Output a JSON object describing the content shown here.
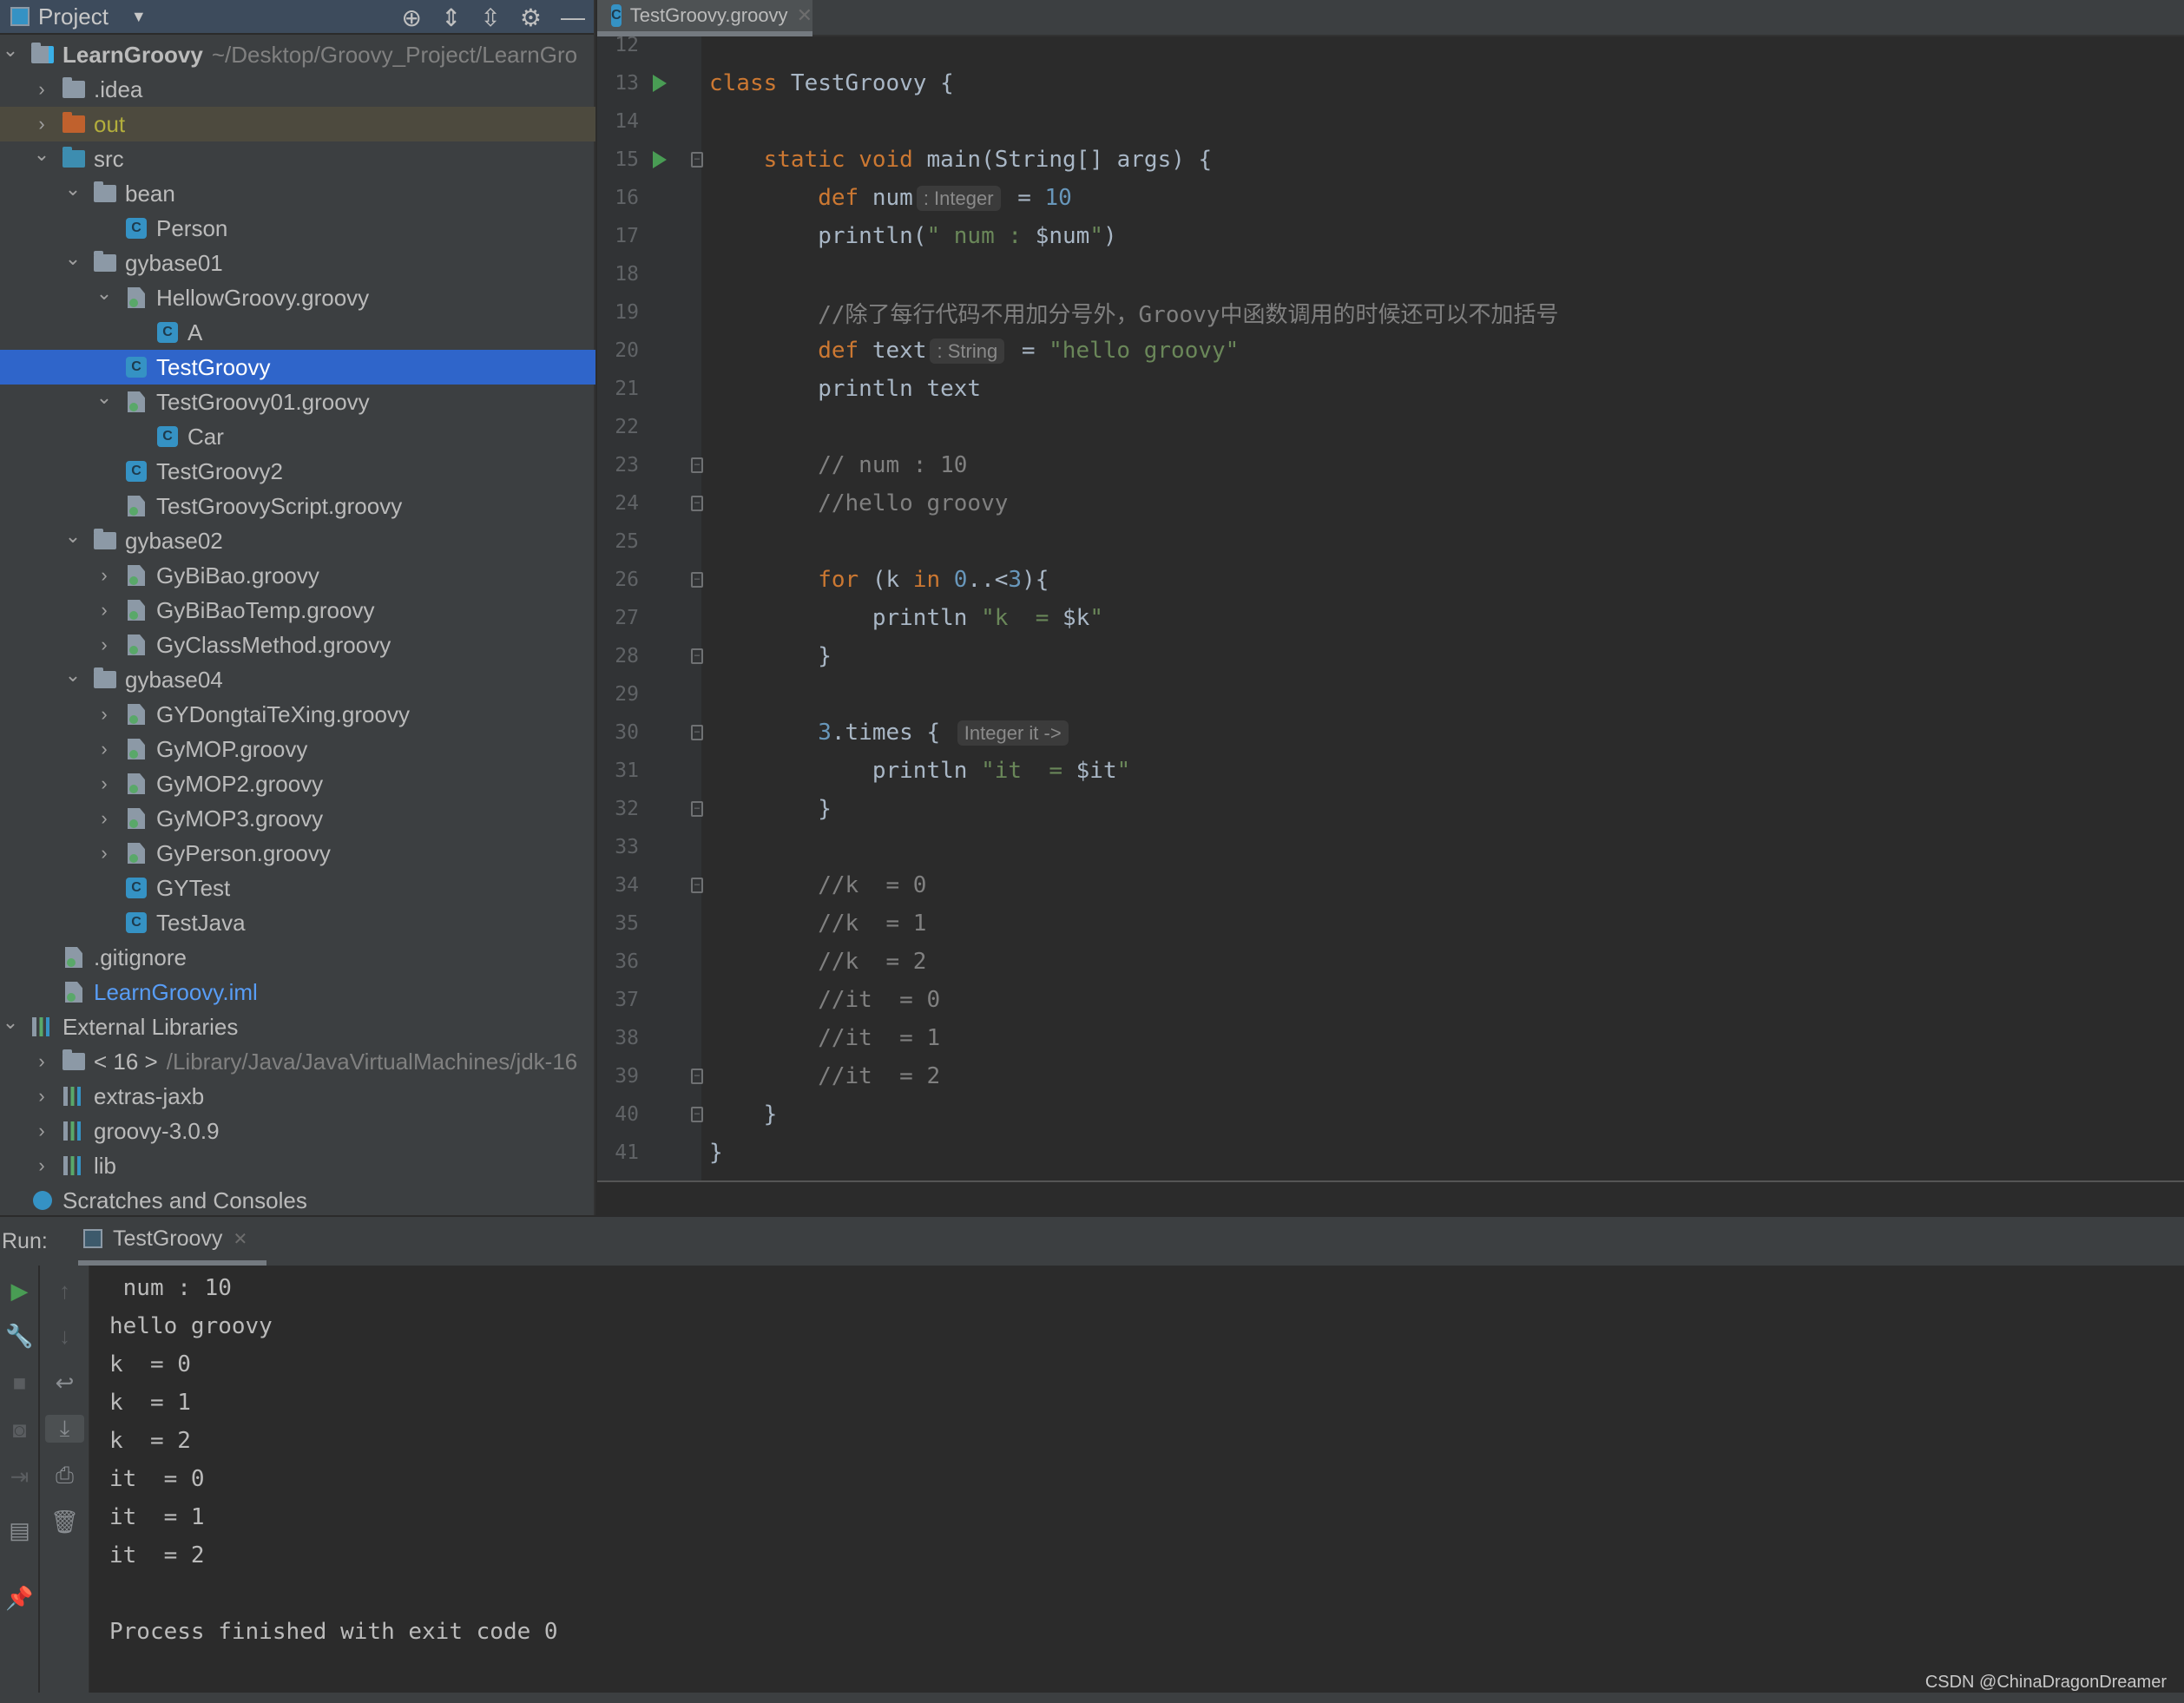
{
  "sidebar": {
    "title": "Project",
    "icons": [
      "target-icon",
      "expand-all-icon",
      "collapse-all-icon",
      "gear-icon",
      "minimize-icon"
    ],
    "items": [
      {
        "level": 0,
        "exp": "open",
        "icon": "module",
        "label": "LearnGroovy",
        "bold": true,
        "extra": "~/Desktop/Groovy_Project/LearnGro"
      },
      {
        "level": 1,
        "exp": "closed",
        "icon": "folder",
        "label": ".idea"
      },
      {
        "level": 1,
        "exp": "closed",
        "icon": "folder-out",
        "label": "out",
        "state": "excluded"
      },
      {
        "level": 1,
        "exp": "open",
        "icon": "folder-src",
        "label": "src"
      },
      {
        "level": 2,
        "exp": "open",
        "icon": "package",
        "label": "bean"
      },
      {
        "level": 3,
        "exp": "none",
        "icon": "class",
        "label": "Person"
      },
      {
        "level": 2,
        "exp": "open",
        "icon": "package",
        "label": "gybase01"
      },
      {
        "level": 3,
        "exp": "open",
        "icon": "groovy",
        "label": "HellowGroovy.groovy"
      },
      {
        "level": 4,
        "exp": "none",
        "icon": "class",
        "label": "A"
      },
      {
        "level": 3,
        "exp": "none",
        "icon": "class",
        "label": "TestGroovy",
        "selected": true
      },
      {
        "level": 3,
        "exp": "open",
        "icon": "groovy",
        "label": "TestGroovy01.groovy"
      },
      {
        "level": 4,
        "exp": "none",
        "icon": "class",
        "label": "Car"
      },
      {
        "level": 3,
        "exp": "none",
        "icon": "class",
        "label": "TestGroovy2"
      },
      {
        "level": 3,
        "exp": "none",
        "icon": "groovy",
        "label": "TestGroovyScript.groovy"
      },
      {
        "level": 2,
        "exp": "open",
        "icon": "package",
        "label": "gybase02"
      },
      {
        "level": 3,
        "exp": "closed",
        "icon": "groovy",
        "label": "GyBiBao.groovy"
      },
      {
        "level": 3,
        "exp": "closed",
        "icon": "groovy",
        "label": "GyBiBaoTemp.groovy"
      },
      {
        "level": 3,
        "exp": "closed",
        "icon": "groovy",
        "label": "GyClassMethod.groovy"
      },
      {
        "level": 2,
        "exp": "open",
        "icon": "package",
        "label": "gybase04"
      },
      {
        "level": 3,
        "exp": "closed",
        "icon": "groovy",
        "label": "GYDongtaiTeXing.groovy"
      },
      {
        "level": 3,
        "exp": "closed",
        "icon": "groovy",
        "label": "GyMOP.groovy"
      },
      {
        "level": 3,
        "exp": "closed",
        "icon": "groovy",
        "label": "GyMOP2.groovy"
      },
      {
        "level": 3,
        "exp": "closed",
        "icon": "groovy",
        "label": "GyMOP3.groovy"
      },
      {
        "level": 3,
        "exp": "closed",
        "icon": "groovy",
        "label": "GyPerson.groovy"
      },
      {
        "level": 3,
        "exp": "none",
        "icon": "class",
        "label": "GYTest"
      },
      {
        "level": 3,
        "exp": "none",
        "icon": "class",
        "label": "TestJava"
      },
      {
        "level": 1,
        "exp": "none",
        "icon": "file",
        "label": ".gitignore"
      },
      {
        "level": 1,
        "exp": "none",
        "icon": "file",
        "label": "LearnGroovy.iml",
        "link": true
      },
      {
        "level": 0,
        "exp": "open",
        "icon": "libraries",
        "label": "External Libraries"
      },
      {
        "level": 1,
        "exp": "closed",
        "icon": "jdk",
        "label": "< 16 >",
        "extra": "/Library/Java/JavaVirtualMachines/jdk-16"
      },
      {
        "level": 1,
        "exp": "closed",
        "icon": "library",
        "label": "extras-jaxb"
      },
      {
        "level": 1,
        "exp": "closed",
        "icon": "library",
        "label": "groovy-3.0.9"
      },
      {
        "level": 1,
        "exp": "closed",
        "icon": "library",
        "label": "lib"
      },
      {
        "level": 0,
        "exp": "none",
        "icon": "scratches",
        "label": "Scratches and Consoles"
      }
    ]
  },
  "editor": {
    "tab": "TestGroovy.groovy",
    "lines": [
      {
        "n": "12",
        "t": []
      },
      {
        "n": "13",
        "run": true,
        "t": [
          [
            "k",
            "class "
          ],
          [
            "d",
            "TestGroovy {"
          ]
        ]
      },
      {
        "n": "14",
        "t": []
      },
      {
        "n": "15",
        "run": true,
        "fold": true,
        "t": [
          [
            "d",
            "    "
          ],
          [
            "k",
            "static void "
          ],
          [
            "d",
            "main(String[] args) {"
          ]
        ]
      },
      {
        "n": "16",
        "t": [
          [
            "d",
            "        "
          ],
          [
            "k",
            "def "
          ],
          [
            "d",
            "num"
          ],
          [
            "h",
            ": Integer"
          ],
          [
            "d",
            " = "
          ],
          [
            "n",
            "10"
          ]
        ]
      },
      {
        "n": "17",
        "t": [
          [
            "d",
            "        println("
          ],
          [
            "s",
            "\" num : "
          ],
          [
            "d",
            "$num"
          ],
          [
            "s",
            "\""
          ],
          [
            "d",
            ")"
          ]
        ]
      },
      {
        "n": "18",
        "t": []
      },
      {
        "n": "19",
        "t": [
          [
            "c",
            "        //除了每行代码不用加分号外，Groovy中函数调用的时候还可以不加括号"
          ]
        ]
      },
      {
        "n": "20",
        "t": [
          [
            "d",
            "        "
          ],
          [
            "k",
            "def "
          ],
          [
            "d",
            "text"
          ],
          [
            "h",
            ": String"
          ],
          [
            "d",
            " = "
          ],
          [
            "s",
            "\"hello groovy\""
          ]
        ]
      },
      {
        "n": "21",
        "t": [
          [
            "d",
            "        println text"
          ]
        ]
      },
      {
        "n": "22",
        "t": []
      },
      {
        "n": "23",
        "fold": true,
        "t": [
          [
            "c",
            "        // num : 10"
          ]
        ]
      },
      {
        "n": "24",
        "fold": true,
        "t": [
          [
            "c",
            "        //hello groovy"
          ]
        ]
      },
      {
        "n": "25",
        "t": []
      },
      {
        "n": "26",
        "fold": true,
        "t": [
          [
            "d",
            "        "
          ],
          [
            "k",
            "for "
          ],
          [
            "d",
            "(k "
          ],
          [
            "k",
            "in "
          ],
          [
            "n",
            "0"
          ],
          [
            "d",
            "..<"
          ],
          [
            "n",
            "3"
          ],
          [
            "d",
            "){"
          ]
        ]
      },
      {
        "n": "27",
        "t": [
          [
            "d",
            "            println "
          ],
          [
            "s",
            "\"k  = "
          ],
          [
            "d",
            "$k"
          ],
          [
            "s",
            "\""
          ]
        ]
      },
      {
        "n": "28",
        "fold": true,
        "t": [
          [
            "d",
            "        }"
          ]
        ]
      },
      {
        "n": "29",
        "t": []
      },
      {
        "n": "30",
        "fold": true,
        "t": [
          [
            "d",
            "        "
          ],
          [
            "n",
            "3"
          ],
          [
            "d",
            ".times { "
          ],
          [
            "h",
            "Integer it ->"
          ]
        ]
      },
      {
        "n": "31",
        "t": [
          [
            "d",
            "            println "
          ],
          [
            "s",
            "\"it  = "
          ],
          [
            "d",
            "$it"
          ],
          [
            "s",
            "\""
          ]
        ]
      },
      {
        "n": "32",
        "fold": true,
        "t": [
          [
            "d",
            "        }"
          ]
        ]
      },
      {
        "n": "33",
        "t": []
      },
      {
        "n": "34",
        "fold": true,
        "t": [
          [
            "c",
            "        //k  = 0"
          ]
        ]
      },
      {
        "n": "35",
        "t": [
          [
            "c",
            "        //k  = 1"
          ]
        ]
      },
      {
        "n": "36",
        "t": [
          [
            "c",
            "        //k  = 2"
          ]
        ]
      },
      {
        "n": "37",
        "t": [
          [
            "c",
            "        //it  = 0"
          ]
        ]
      },
      {
        "n": "38",
        "t": [
          [
            "c",
            "        //it  = 1"
          ]
        ]
      },
      {
        "n": "39",
        "fold": true,
        "t": [
          [
            "c",
            "        //it  = 2"
          ]
        ]
      },
      {
        "n": "40",
        "fold": true,
        "t": [
          [
            "d",
            "    }"
          ]
        ]
      },
      {
        "n": "41",
        "t": [
          [
            "d",
            "}"
          ]
        ]
      }
    ]
  },
  "run": {
    "label": "Run:",
    "tab": "TestGroovy",
    "output": [
      " num : 10",
      "hello groovy",
      "k  = 0",
      "k  = 1",
      "k  = 2",
      "it  = 0",
      "it  = 1",
      "it  = 2",
      "",
      "Process finished with exit code 0"
    ]
  },
  "watermark": "CSDN @ChinaDragonDreamer",
  "colors": {
    "keyword": "#cc7832",
    "string": "#6a8759",
    "number": "#6897bb",
    "comment": "#808080",
    "selection": "#2f65ca"
  }
}
